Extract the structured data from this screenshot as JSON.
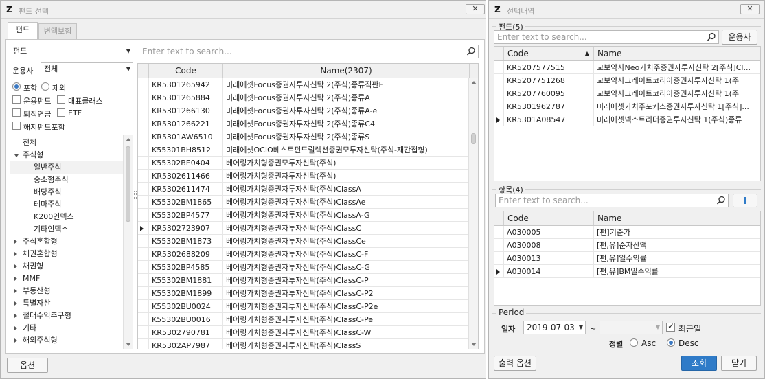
{
  "left_window": {
    "title": "펀드 선택",
    "close": "✕",
    "tabs": [
      "펀드",
      "변액보험"
    ],
    "fund_type_select": "펀드",
    "manager_label": "운용사",
    "manager_select": "전체",
    "radio_include": "포함",
    "radio_exclude": "제외",
    "chk_operating": "운용펀드",
    "chk_rep_class": "대표클래스",
    "chk_pension": "퇴직연금",
    "chk_etf": "ETF",
    "chk_overseas": "해지펀드포함",
    "search_placeholder": "Enter text to search...",
    "options_button": "옵션",
    "tree": [
      {
        "label": "전체",
        "level": 0,
        "state": "none"
      },
      {
        "label": "주식형",
        "level": 0,
        "state": "expanded"
      },
      {
        "label": "일반주식",
        "level": 1,
        "state": "none",
        "selected": true
      },
      {
        "label": "중소형주식",
        "level": 1,
        "state": "none"
      },
      {
        "label": "배당주식",
        "level": 1,
        "state": "none"
      },
      {
        "label": "테마주식",
        "level": 1,
        "state": "none"
      },
      {
        "label": "K200인덱스",
        "level": 1,
        "state": "none"
      },
      {
        "label": "기타인덱스",
        "level": 1,
        "state": "none"
      },
      {
        "label": "주식혼합형",
        "level": 0,
        "state": "collapsed"
      },
      {
        "label": "채권혼합형",
        "level": 0,
        "state": "collapsed"
      },
      {
        "label": "채권형",
        "level": 0,
        "state": "collapsed"
      },
      {
        "label": "MMF",
        "level": 0,
        "state": "collapsed"
      },
      {
        "label": "부동산형",
        "level": 0,
        "state": "collapsed"
      },
      {
        "label": "특별자산",
        "level": 0,
        "state": "collapsed"
      },
      {
        "label": "절대수익추구형",
        "level": 0,
        "state": "collapsed"
      },
      {
        "label": "기타",
        "level": 0,
        "state": "collapsed"
      },
      {
        "label": "해외주식형",
        "level": 0,
        "state": "collapsed"
      }
    ],
    "grid": {
      "headers": [
        "Code",
        "Name(2307)"
      ],
      "rows": [
        [
          "KR5301265942",
          "미래에셋Focus증권자투자신탁 2(주식)종류직판F"
        ],
        [
          "KR5301265884",
          "미래에셋Focus증권자투자신탁 2(주식)종류A"
        ],
        [
          "KR5301266130",
          "미래에셋Focus증권자투자신탁 2(주식)종류A-e"
        ],
        [
          "KR5301266221",
          "미래에셋Focus증권자투자신탁 2(주식)종류C4"
        ],
        [
          "KR5301AW6510",
          "미래에셋Focus증권자투자신탁 2(주식)종류S"
        ],
        [
          "K55301BH8512",
          "미래에셋OCIO베스트펀드릴렉션증권모투자신탁(주식-재간접형)"
        ],
        [
          "K55302BE0404",
          "베어링가치형증권모투자신탁(주식)"
        ],
        [
          "KR5302611466",
          "베어링가치형증권자투자신탁(주식)"
        ],
        [
          "KR5302611474",
          "베어링가치형증권자투자신탁(주식)ClassA"
        ],
        [
          "K55302BM1865",
          "베어링가치형증권자투자신탁(주식)ClassAe"
        ],
        [
          "K55302BP4577",
          "베어링가치형증권자투자신탁(주식)ClassA-G"
        ],
        [
          "KR5302723907",
          "베어링가치형증권자투자신탁(주식)ClassC"
        ],
        [
          "K55302BM1873",
          "베어링가치형증권자투자신탁(주식)ClassCe"
        ],
        [
          "KR5302688209",
          "베어링가치형증권자투자신탁(주식)ClassC-F"
        ],
        [
          "K55302BP4585",
          "베어링가치형증권자투자신탁(주식)ClassC-G"
        ],
        [
          "K55302BM1881",
          "베어링가치형증권자투자신탁(주식)ClassC-P"
        ],
        [
          "K55302BM1899",
          "베어링가치형증권자투자신탁(주식)ClassC-P2"
        ],
        [
          "K55302BU0024",
          "베어링가치형증권자투자신탁(주식)ClassC-P2e"
        ],
        [
          "K55302BU0016",
          "베어링가치형증권자투자신탁(주식)ClassC-Pe"
        ],
        [
          "KR5302790781",
          "베어링가치형증권자투자신탁(주식)ClassC-W"
        ],
        [
          "KR5302AP7987",
          "베어링가치형증권자투자신탁(주식)ClassS"
        ]
      ],
      "current_row": 11
    }
  },
  "right_window": {
    "title": "선택내역",
    "close": "✕",
    "funds_group": "펀드(5)",
    "funds_search_placeholder": "Enter text to search...",
    "manager_button": "운용사",
    "funds_headers": [
      "Code",
      "Name"
    ],
    "funds_rows": [
      [
        "KR5207577515",
        "교보악사Neo가치주증권자투자신탁 2[주식]Cl..."
      ],
      [
        "KR5207751268",
        "교보악사그레이트코리아증권자투자신탁 1(주"
      ],
      [
        "KR5207760095",
        "교보악사그레이트코리아증권자투자신탁 1(주"
      ],
      [
        "KR5301962787",
        "미래에셋가치주포커스증권자투자신탁 1[주식]..."
      ],
      [
        "KR5301A08547",
        "미래에셋넥스트리더증권투자신탁 1(주식)종류"
      ]
    ],
    "funds_current_row": 4,
    "items_group": "항목(4)",
    "items_search_placeholder": "Enter text to search...",
    "items_headers": [
      "Code",
      "Name"
    ],
    "items_rows": [
      [
        "A030005",
        "[펀]기준가"
      ],
      [
        "A030008",
        "[펀,유]순자산액"
      ],
      [
        "A030013",
        "[펀,유]일수익률"
      ],
      [
        "A030014",
        "[펀,유]BM일수익률"
      ]
    ],
    "items_current_row": 3,
    "period_group": "Period",
    "date_label": "일자",
    "date_from": "2019-07-03",
    "tilde": "~",
    "date_to": "",
    "chk_recent": "최근일",
    "sort_label": "정렬",
    "sort_asc": "Asc",
    "sort_desc": "Desc",
    "print_options_button": "출력 옵션",
    "query_button": "조회",
    "close_button": "닫기"
  }
}
